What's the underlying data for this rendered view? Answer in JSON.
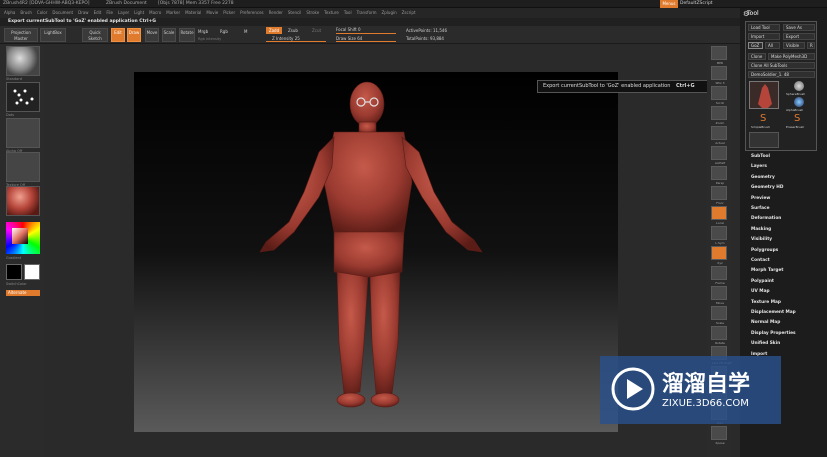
{
  "title": {
    "app": "ZBrush4R2 [DDVA-GHHW-ABQ3-KEPO]",
    "doc": "ZBrush Document",
    "mem": "[Objs 7878] Mem 3357 Free 2278",
    "hint": "Export currentSubTool to 'GoZ' enabled application  Ctrl+G",
    "menu_btn": "Menus",
    "script": "DefaultZScript"
  },
  "menus": [
    "Alpha",
    "Brush",
    "Color",
    "Document",
    "Draw",
    "Edit",
    "File",
    "Layer",
    "Light",
    "Macro",
    "Marker",
    "Material",
    "Movie",
    "Picker",
    "Preferences",
    "Render",
    "Stencil",
    "Stroke",
    "Texture",
    "Tool",
    "Transform",
    "Zplugin",
    "Zscript"
  ],
  "toolbar": {
    "projection": "Projection Master",
    "lightbox": "LightBox",
    "quick": "Quick Sketch",
    "edit": "Edit",
    "draw": "Draw",
    "move": "Move",
    "scale": "Scale",
    "rotate": "Rotate",
    "mrgb": "Mrgb",
    "rgb": "Rgb",
    "m": "M",
    "rgb_intensity": "Rgb Intensity",
    "zadd": "Zadd",
    "zsub": "Zsub",
    "zcut": "Zcut",
    "z_intensity": "Z Intensity 25",
    "focal_shift": "Focal Shift 0",
    "draw_size": "Draw Size 64",
    "active_points": "ActivePoints: 11,546",
    "total_points": "TotalPoints: 93,884"
  },
  "left": {
    "standard": "Standard",
    "dots": "Dots",
    "alpha_off": "Alpha Off",
    "texture_off": "Texture Off",
    "material": "MatCap",
    "gradient": "Gradient",
    "switch_color": "SwitchColor",
    "alternate": "Alternate"
  },
  "tooltip": {
    "text": "Export currentSubTool to 'GoZ' enabled application",
    "shortcut": "Ctrl+G"
  },
  "shelf": [
    "BPR",
    "SPix 3",
    "Scroll",
    "Zoom",
    "Actual",
    "AAHalf",
    "Persp",
    "Floor",
    "Local",
    "L.Sym",
    "Xyz",
    "Frame",
    "Move",
    "Scale",
    "Rotate",
    "Line Fill PolyF",
    "Transp",
    "Ghost",
    "Solo",
    "Xpose"
  ],
  "toolpanel": {
    "header": "Tool",
    "load": "Load Tool",
    "save": "Save As",
    "import": "Import",
    "export": "Export",
    "goz": "GoZ",
    "all": "All",
    "visible": "Visible",
    "r": "R",
    "clone": "Clone",
    "make": "Make PolyMesh3D",
    "clone_all": "Clone All SubTools",
    "holder": "DemoSoldier_1. 48",
    "brushes": [
      "SphereBrush",
      "AlphaBrush",
      "SimpleBrush",
      "EraserBrush"
    ],
    "items": [
      "SubTool",
      "Layers",
      "Geometry",
      "Geometry HD",
      "Preview",
      "Surface",
      "Deformation",
      "Masking",
      "Visibility",
      "Polygroups",
      "Contact",
      "Morph Target",
      "Polypaint",
      "UV Map",
      "Texture Map",
      "Displacement Map",
      "Normal Map",
      "Display Properties",
      "Unified Skin",
      "Import"
    ]
  },
  "watermark": {
    "brand": "溜溜自学",
    "url": "ZIXUE.3D66.COM"
  },
  "colors": {
    "accent": "#e07a2c",
    "mesh": "#b5453a"
  }
}
